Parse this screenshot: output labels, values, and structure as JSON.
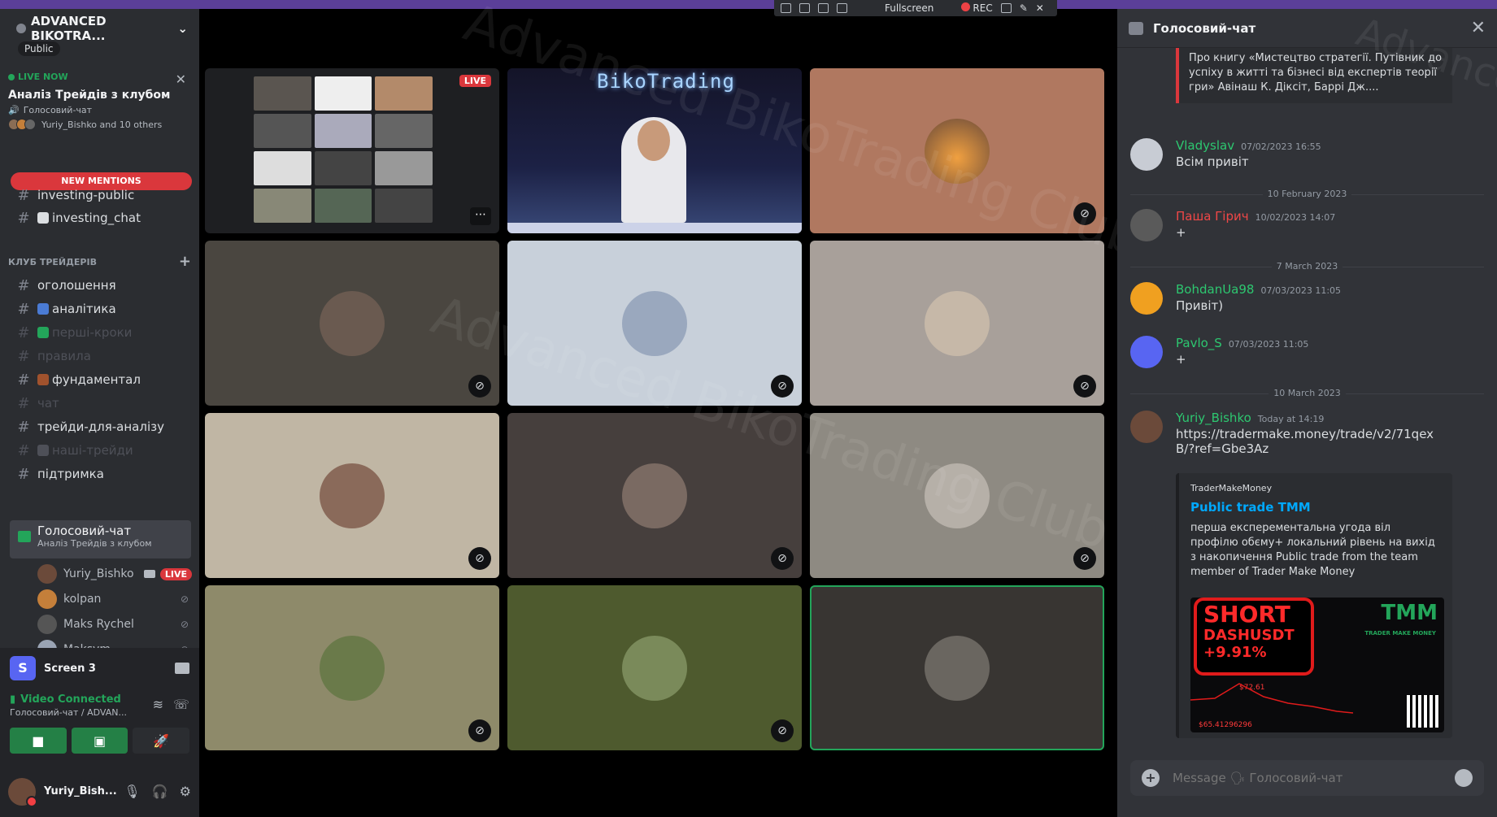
{
  "recorder": {
    "fullscreen": "Fullscreen",
    "rec": "REC"
  },
  "server": {
    "name": "ADVANCED BIKOTRA...",
    "visibility": "Public"
  },
  "live_card": {
    "label": "LIVE NOW",
    "title": "Аналіз Трейдів з клубом",
    "channel": "Голосовий-чат",
    "members": "Yuriy_Bishko and 10 others"
  },
  "new_mentions": "NEW MENTIONS",
  "channels_top": [
    {
      "label": "investing-public"
    },
    {
      "label": "investing_chat"
    }
  ],
  "category": {
    "label": "КЛУБ ТРЕЙДЕРІВ"
  },
  "channels": [
    {
      "label": "оголошення",
      "muted": false
    },
    {
      "label": "аналітика",
      "muted": false
    },
    {
      "label": "перші-кроки",
      "muted": true
    },
    {
      "label": "правила",
      "muted": true
    },
    {
      "label": "фундаментал",
      "muted": false
    },
    {
      "label": "чат",
      "muted": true
    },
    {
      "label": "трейди-для-аналізу",
      "muted": false
    },
    {
      "label": "наші-трейди",
      "muted": true
    },
    {
      "label": "підтримка",
      "muted": false
    }
  ],
  "voice_channel": {
    "label": "Голосовий-чат",
    "sub": "Аналіз Трейдів з клубом"
  },
  "voice_members": [
    {
      "name": "Yuriy_Bishko",
      "live": "LIVE"
    },
    {
      "name": "kolpan"
    },
    {
      "name": "Maks Rychel"
    },
    {
      "name": "Maksym"
    }
  ],
  "screen_share": {
    "label": "Screen 3"
  },
  "voice_status": {
    "label": "Video Connected",
    "sub": "Голосовий-чат / ADVAN..."
  },
  "user": {
    "name": "Yuriy_Bish..."
  },
  "stream": {
    "live": "LIVE",
    "neon": "BikoTrading"
  },
  "watermark": "Advanced BikoTrading Club",
  "chat": {
    "title": "Голосовий-чат",
    "quote": "Про книгу «Мистецтво стратегії. Путівник до успіху в житті та бізнесі від експертів теорії гри» Авінаш К. Діксіт, Баррі Дж....",
    "messages": [
      {
        "author": "Vladyslav",
        "time": "07/02/2023 16:55",
        "text": "Всім привіт",
        "color": "#2dc770"
      },
      {
        "author": "Паша Гірич",
        "time": "10/02/2023 14:07",
        "text": "+",
        "color": "#f04747"
      },
      {
        "author": "BohdanUa98",
        "time": "07/03/2023 11:05",
        "text": "Привіт)",
        "color": "#2dc770"
      },
      {
        "author": "Pavlo_S",
        "time": "07/03/2023 11:05",
        "text": "+",
        "color": "#2dc770"
      },
      {
        "author": "Yuriy_Bishko",
        "time": "Today at 14:19",
        "text": "https://tradermake.money/trade/v2/71qexB/?ref=Gbe3Az",
        "color": "#2dc770"
      }
    ],
    "dividers": [
      "10 February 2023",
      "7 March 2023",
      "10 March 2023"
    ],
    "embed": {
      "provider": "TraderMakeMoney",
      "title": "Public trade TMM",
      "description": "перша експерементальна угода віл профілю обєму+ локальний рівень на вихід з накопичення Public trade from the team member of Trader Make Money",
      "short": "SHORT",
      "pair": "DASHUSDT",
      "pnl": "+9.91%",
      "price_high": "$72.61",
      "price_low": "$65.41296296",
      "brand": "TMM",
      "brand_text": "TRADER MAKE MONEY"
    },
    "composer_placeholder": "Message 🗣 Голосовий-чат"
  }
}
